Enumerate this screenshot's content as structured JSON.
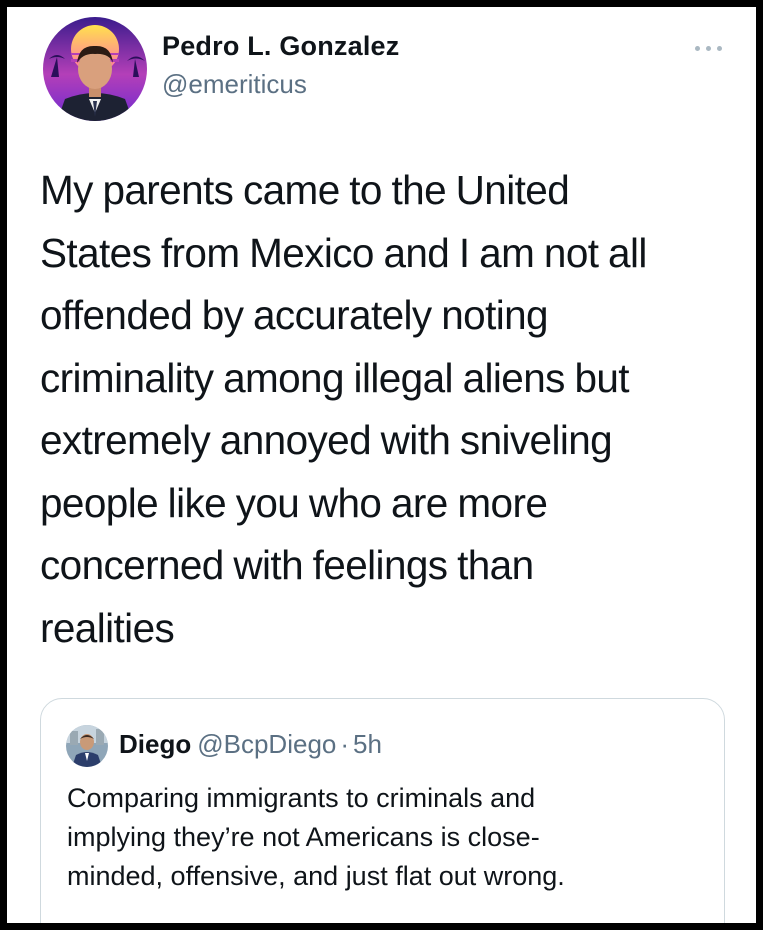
{
  "tweet": {
    "author": {
      "display_name": "Pedro L. Gonzalez",
      "handle": "@emeriticus"
    },
    "text": "My parents came to the United\nStates from Mexico and I am not all\noffended by accurately noting\ncriminality among illegal aliens but\nextremely annoyed with sniveling\npeople like you who are more\nconcerned with feelings than\nrealities",
    "quoted": {
      "display_name": "Diego",
      "handle": "@BcpDiego",
      "separator": "·",
      "time": "5h",
      "text": "Comparing immigrants to criminals and\nimplying they’re not Americans is close-\nminded, offensive, and just flat out wrong."
    }
  },
  "icons": {
    "more": "more-horizontal-icon"
  },
  "colors": {
    "frame": "#000000",
    "background": "#ffffff",
    "primary_text": "#0f1419",
    "secondary_text": "#5b7083",
    "border": "#cfd9de",
    "more_dots": "#aab8c2"
  }
}
